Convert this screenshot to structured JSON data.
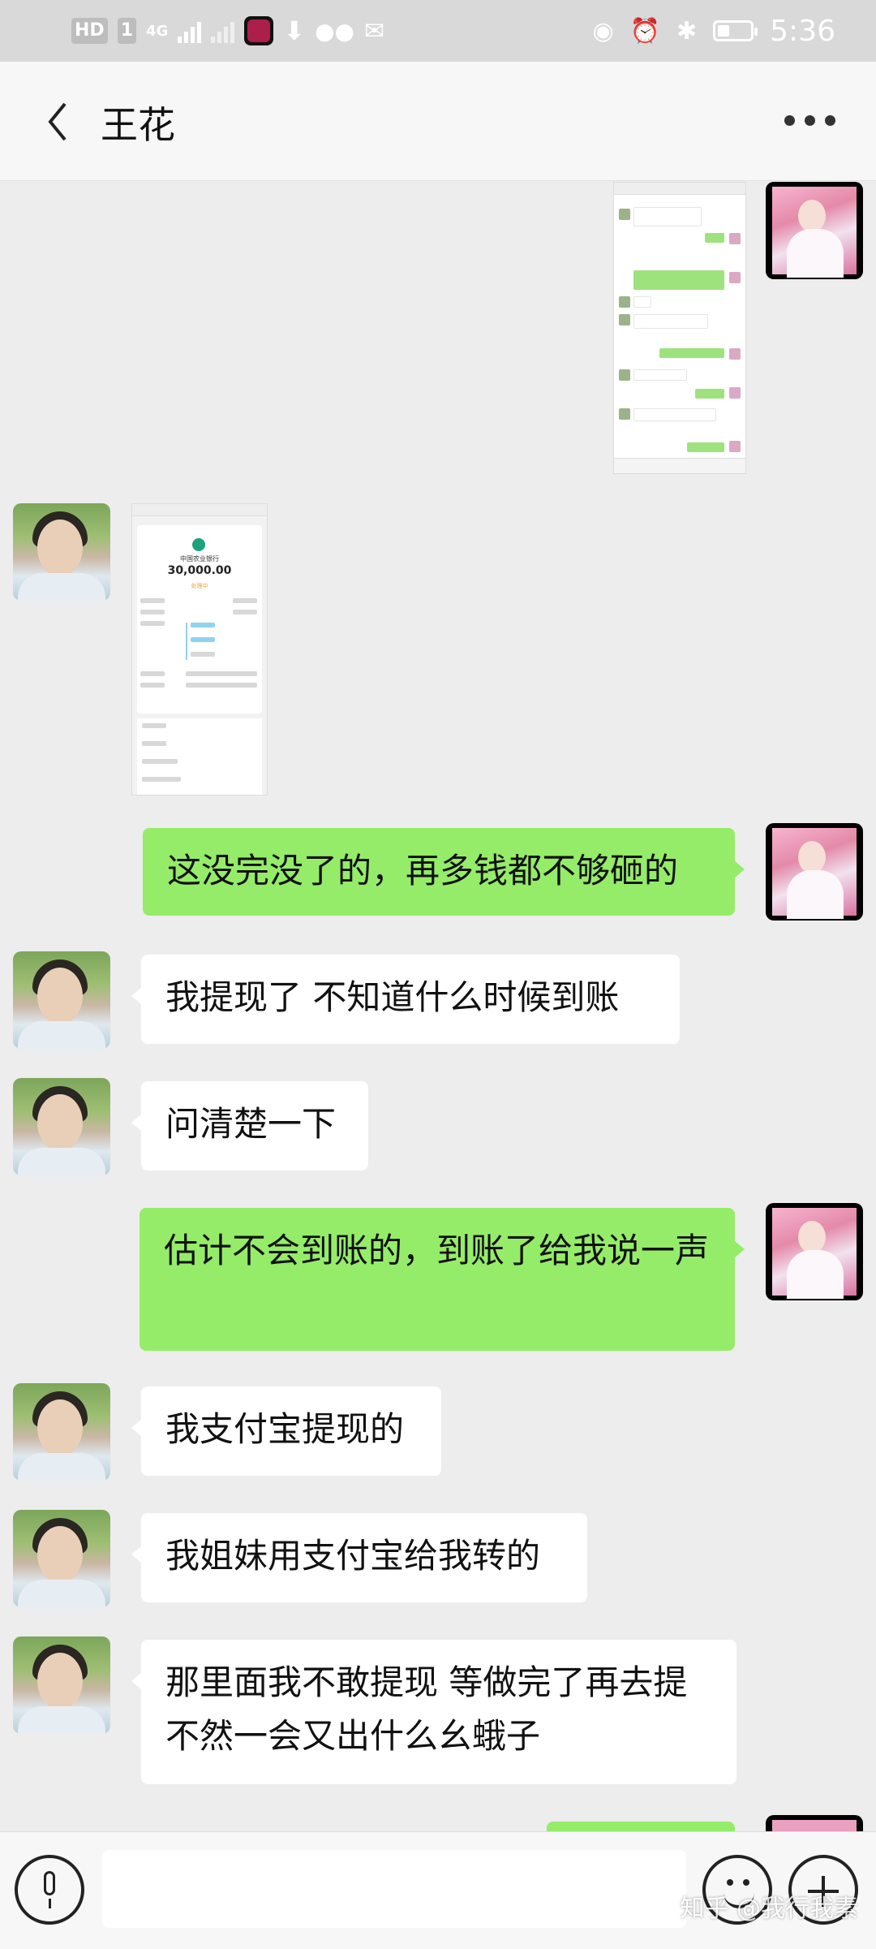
{
  "status_bar": {
    "network_badge": "HD",
    "sim_number": "1",
    "network_type": "4G",
    "time": "5:36",
    "icons": [
      "signal-icon",
      "tiktok-icon",
      "download-icon",
      "wechat-icon",
      "mail-icon",
      "eye-icon",
      "alarm-icon",
      "bluetooth-icon",
      "battery-icon"
    ]
  },
  "header": {
    "title": "王花",
    "back_icon": "chevron-left-icon",
    "more_icon": "more-dots-icon"
  },
  "messages": [
    {
      "side": "right",
      "type": "image",
      "image": "chat-screenshot"
    },
    {
      "side": "left",
      "type": "image",
      "image": "transfer-receipt-screenshot",
      "receipt": {
        "bank": "中国农业银行",
        "amount": "30,000.00",
        "status": "处理中"
      }
    },
    {
      "side": "right",
      "type": "text",
      "text": "这没完没了的，再多钱都不够砸的"
    },
    {
      "side": "left",
      "type": "text",
      "text": "我提现了  不知道什么时候到账"
    },
    {
      "side": "left",
      "type": "text",
      "text": "问清楚一下"
    },
    {
      "side": "right",
      "type": "text",
      "text": "估计不会到账的，到账了给我说一声"
    },
    {
      "side": "left",
      "type": "text",
      "text": "我支付宝提现的"
    },
    {
      "side": "left",
      "type": "text",
      "text": "我姐妹用支付宝给我转的"
    },
    {
      "side": "left",
      "type": "text",
      "text": "那里面我不敢提现  等做完了再去提  不然一会又出什么幺蛾子"
    }
  ],
  "input_bar": {
    "voice_icon": "microphone-icon",
    "input_value": "",
    "emoji_icon": "emoji-icon",
    "plus_icon": "plus-icon"
  },
  "watermark": "知乎 @我行我素",
  "colors": {
    "outgoing_bubble": "#95ec69",
    "incoming_bubble": "#ffffff",
    "background": "#ededed"
  }
}
